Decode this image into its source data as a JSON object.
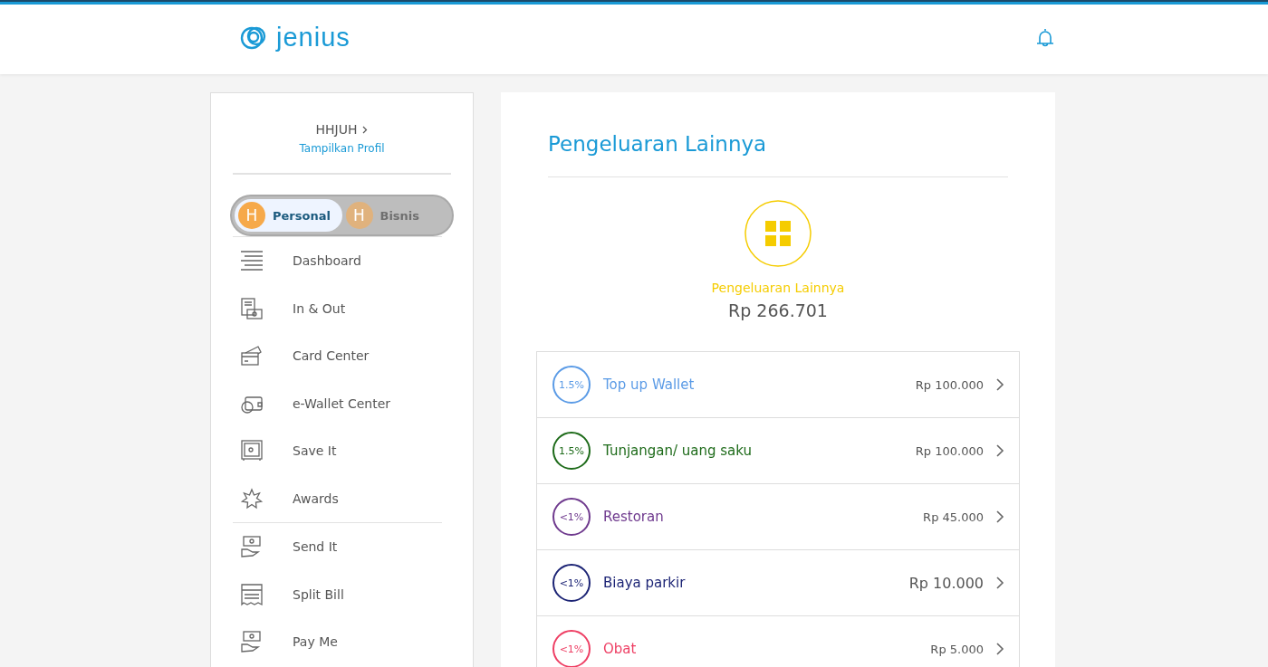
{
  "header": {
    "logo_text": "jenius"
  },
  "profile": {
    "name": "HHJUH",
    "link": "Tampilkan Profil"
  },
  "account_switch": [
    {
      "initial": "H",
      "label": "Personal",
      "selected": true
    },
    {
      "initial": "H",
      "label": "Bisnis",
      "selected": false
    }
  ],
  "menu_sections": [
    {
      "items": [
        {
          "label": "Dashboard"
        },
        {
          "label": "In & Out"
        },
        {
          "label": "Card Center"
        },
        {
          "label": "e-Wallet Center"
        },
        {
          "label": "Save It"
        },
        {
          "label": "Awards"
        }
      ]
    },
    {
      "items": [
        {
          "label": "Send It"
        },
        {
          "label": "Split Bill"
        },
        {
          "label": "Pay Me"
        }
      ]
    }
  ],
  "main": {
    "title": "Pengeluaran Lainnya",
    "category": {
      "label": "Pengeluaran Lainnya",
      "amount": "Rp 266.701",
      "color": "#f5cc00"
    },
    "rows": [
      {
        "percent": "1.5%",
        "label": "Top up Wallet",
        "amount": "Rp 100.000",
        "color": "#5b9be6"
      },
      {
        "percent": "1.5%",
        "label": "Tunjangan/ uang saku",
        "amount": "Rp 100.000",
        "color": "#1e6b1a"
      },
      {
        "percent": "<1%",
        "label": "Restoran",
        "amount": "Rp 45.000",
        "color": "#6f3a8e"
      },
      {
        "percent": "<1%",
        "label": "Biaya parkir",
        "amount": "Rp 10.000",
        "color": "#1c2475"
      },
      {
        "percent": "<1%",
        "label": "Obat",
        "amount": "Rp 5.000",
        "color": "#ee3f64"
      }
    ]
  }
}
